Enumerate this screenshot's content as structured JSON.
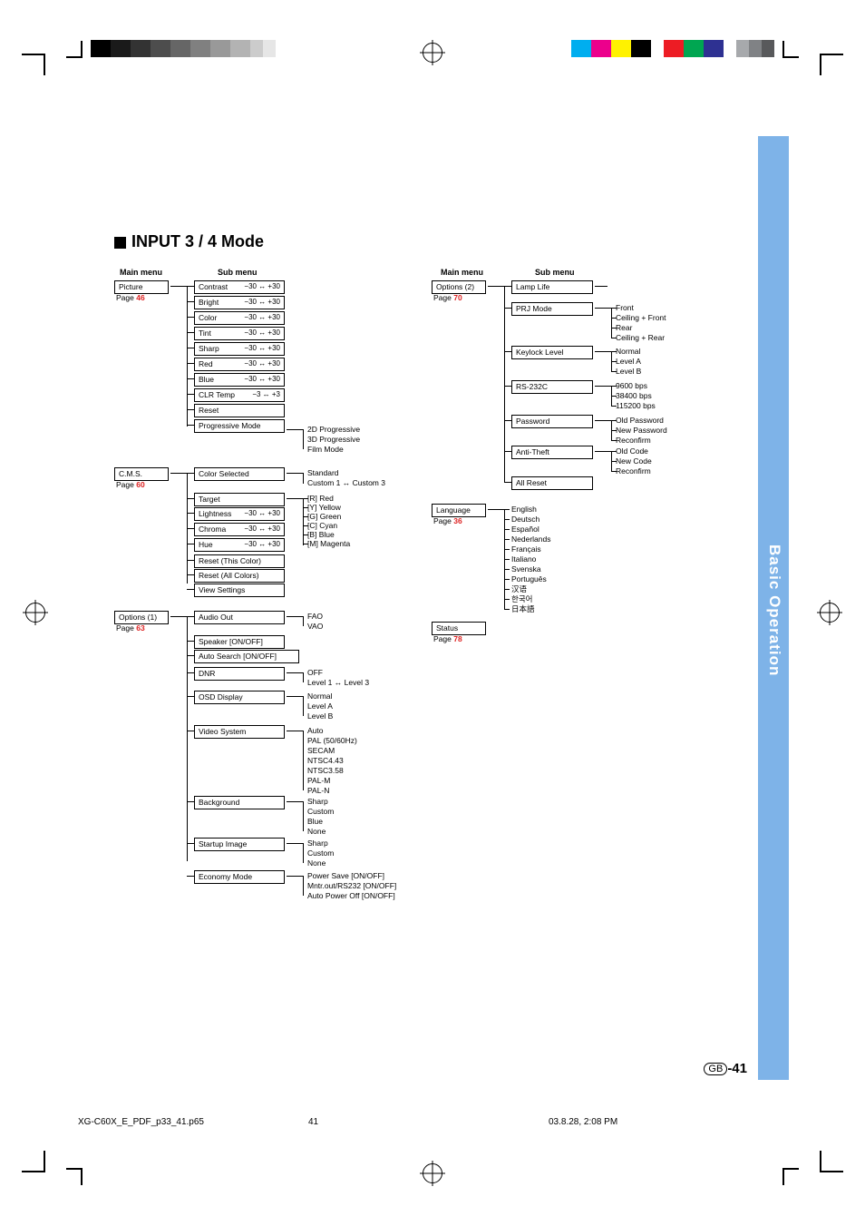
{
  "section_title": "INPUT 3 / 4 Mode",
  "side_tab": "Basic Operation",
  "page_number": "-41",
  "page_gb": "GB",
  "footer": {
    "file": "XG-C60X_E_PDF_p33_41.p65",
    "page": "41",
    "timestamp": "03.8.28, 2:08 PM"
  },
  "headers": {
    "main1": "Main menu",
    "sub1": "Sub menu",
    "main2": "Main menu",
    "sub2": "Sub menu"
  },
  "left_col": {
    "picture": {
      "title": "Picture",
      "page_word": "Page",
      "page": "46"
    },
    "cms": {
      "title": "C.M.S.",
      "page_word": "Page",
      "page": "60"
    },
    "options1": {
      "title": "Options (1)",
      "page_word": "Page",
      "page": "63"
    }
  },
  "picture_sub": [
    {
      "name": "Contrast",
      "range": "−30 ↔ +30"
    },
    {
      "name": "Bright",
      "range": "−30 ↔ +30"
    },
    {
      "name": "Color",
      "range": "−30 ↔ +30"
    },
    {
      "name": "Tint",
      "range": "−30 ↔ +30"
    },
    {
      "name": "Sharp",
      "range": "−30 ↔ +30"
    },
    {
      "name": "Red",
      "range": "−30 ↔ +30"
    },
    {
      "name": "Blue",
      "range": "−30 ↔ +30"
    },
    {
      "name": "CLR Temp",
      "range": "−3 ↔ +3"
    },
    {
      "name": "Reset",
      "range": ""
    },
    {
      "name": "Progressive Mode",
      "range": ""
    }
  ],
  "progressive_leaves": [
    "2D Progressive",
    "3D Progressive",
    "Film Mode"
  ],
  "cms_sub": {
    "color_selected": "Color Selected",
    "color_selected_leaves": [
      "Standard",
      "Custom 1 ↔ Custom 3"
    ],
    "target": "Target",
    "target_leaves": [
      "[R] Red",
      "[Y] Yellow",
      "[G] Green",
      "[C] Cyan",
      "[B] Blue",
      "[M] Magenta"
    ],
    "adjustments": [
      {
        "name": "Lightness",
        "range": "−30 ↔ +30"
      },
      {
        "name": "Chroma",
        "range": "−30 ↔ +30"
      },
      {
        "name": "Hue",
        "range": "−30 ↔ +30"
      }
    ],
    "reset_this": "Reset (This Color)",
    "reset_all": "Reset (All Colors)",
    "view_settings": "View Settings"
  },
  "options1_sub": {
    "audio_out": "Audio Out",
    "audio_leaves": [
      "FAO",
      "VAO"
    ],
    "speaker": "Speaker [ON/OFF]",
    "auto_search": "Auto Search [ON/OFF]",
    "dnr": "DNR",
    "dnr_leaves": [
      "OFF",
      "Level 1 ↔ Level 3"
    ],
    "osd": "OSD Display",
    "osd_leaves": [
      "Normal",
      "Level A",
      "Level B"
    ],
    "video_system": "Video System",
    "video_leaves": [
      "Auto",
      "PAL (50/60Hz)",
      "SECAM",
      "NTSC4.43",
      "NTSC3.58",
      "PAL-M",
      "PAL-N"
    ],
    "background": "Background",
    "background_leaves": [
      "Sharp",
      "Custom",
      "Blue",
      "None"
    ],
    "startup": "Startup Image",
    "startup_leaves": [
      "Sharp",
      "Custom",
      "None"
    ],
    "economy": "Economy Mode",
    "economy_leaves": [
      "Power Save [ON/OFF]",
      "Mntr.out/RS232 [ON/OFF]",
      "Auto Power Off [ON/OFF]"
    ]
  },
  "right_col": {
    "options2": {
      "title": "Options (2)",
      "page_word": "Page",
      "page": "70"
    },
    "language": {
      "title": "Language",
      "page_word": "Page",
      "page": "36"
    },
    "status": {
      "title": "Status",
      "page_word": "Page",
      "page": "78"
    }
  },
  "options2_sub": {
    "lamp": "Lamp Life",
    "prj": "PRJ Mode",
    "prj_leaves": [
      "Front",
      "Ceiling + Front",
      "Rear",
      "Ceiling + Rear"
    ],
    "keylock": "Keylock Level",
    "keylock_leaves": [
      "Normal",
      "Level A",
      "Level B"
    ],
    "rs232": "RS-232C",
    "rs232_leaves": [
      "9600 bps",
      "38400 bps",
      "115200 bps"
    ],
    "password": "Password",
    "password_leaves": [
      "Old Password",
      "New Password",
      "Reconfirm"
    ],
    "antitheft": "Anti-Theft",
    "antitheft_leaves": [
      "Old Code",
      "New Code",
      "Reconfirm"
    ],
    "all_reset": "All Reset"
  },
  "language_leaves": [
    "English",
    "Deutsch",
    "Español",
    "Nederlands",
    "Français",
    "Italiano",
    "Svenska",
    "Português",
    "汉语",
    "한국어",
    "日本語"
  ]
}
